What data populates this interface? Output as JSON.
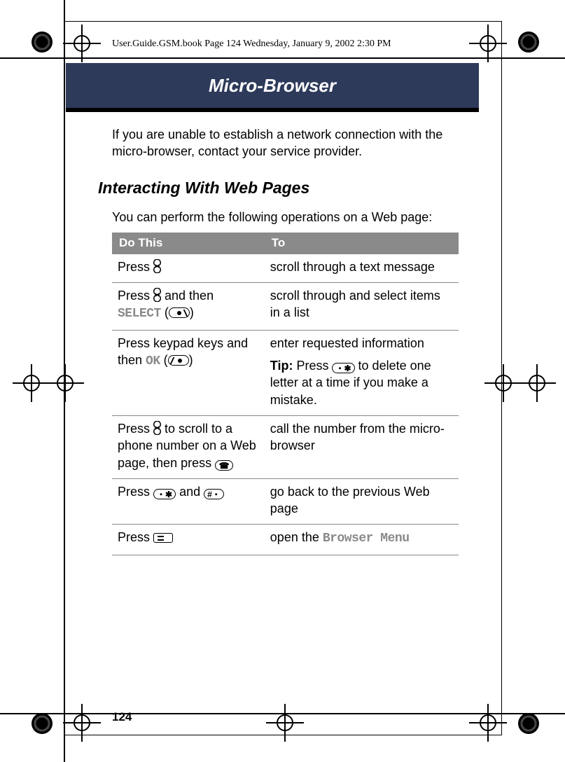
{
  "header_meta": "User.Guide.GSM.book  Page 124  Wednesday, January 9, 2002  2:30 PM",
  "title": "Micro-Browser",
  "page_number": "124",
  "intro": "If you are unable to establish a network connection with the micro-browser, contact your service provider.",
  "section_heading": "Interacting With Web Pages",
  "section_lead": "You can perform the following operations on a Web page:",
  "table": {
    "head_do": "Do This",
    "head_to": "To",
    "rows": [
      {
        "do_pre": "Press ",
        "do_post": "",
        "to": "scroll through a text message"
      },
      {
        "do_pre": "Press ",
        "do_mid": " and then ",
        "do_select": "SELECT",
        "do_post": " (",
        "do_close": ")",
        "to": "scroll through and select items in a list"
      },
      {
        "do_pre": "Press keypad keys and then ",
        "do_ok": "OK",
        "do_post": " (",
        "do_close": ")",
        "to_a": "enter requested information",
        "tip_label": "Tip:",
        "tip_pre": " Press ",
        "tip_post": " to delete one letter at a time if you make a mistake."
      },
      {
        "do_pre": "Press ",
        "do_mid": " to scroll to a phone number on a Web page, then press ",
        "to": "call the number from the micro-browser"
      },
      {
        "do_pre": "Press ",
        "do_and": " and ",
        "to": "go back to the previous Web page"
      },
      {
        "do_pre": "Press ",
        "to_pre": "open the ",
        "to_menu": "Browser Menu"
      }
    ]
  }
}
